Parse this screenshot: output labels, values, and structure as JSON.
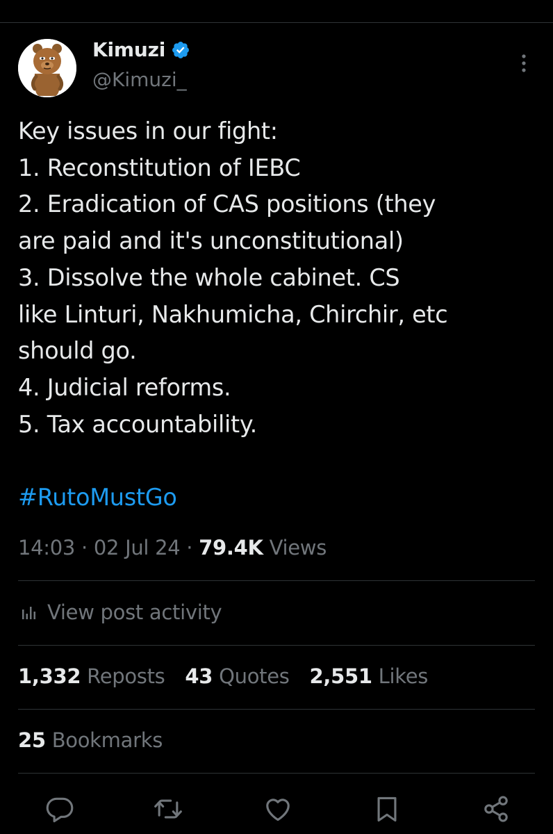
{
  "tweet": {
    "author": {
      "display_name": "Kimuzi",
      "handle": "@Kimuzi_",
      "verified": true,
      "avatar_icon": "cartoon-character-avatar"
    },
    "more_icon": "more-vertical-icon",
    "lines": [
      "Key issues in our fight:",
      "1. Reconstitution of IEBC",
      "2. Eradication of CAS positions (they",
      "are paid and it's unconstitutional)",
      "3. Dissolve the whole cabinet. CS",
      "like Linturi, Nakhumicha, Chirchir, etc",
      "should go.",
      "4. Judicial reforms.",
      "5. Tax accountability."
    ],
    "hashtag": "#RutoMustGo",
    "time": "14:03",
    "date": "02 Jul 24",
    "views_count": "79.4K",
    "views_label": "Views",
    "separator": "·",
    "activity_label": "View post activity",
    "stats": {
      "reposts_count": "1,332",
      "reposts_label": "Reposts",
      "quotes_count": "43",
      "quotes_label": "Quotes",
      "likes_count": "2,551",
      "likes_label": "Likes"
    },
    "bookmarks_count": "25",
    "bookmarks_label": "Bookmarks"
  },
  "actions": [
    "reply-icon",
    "repost-icon",
    "like-icon",
    "bookmark-icon",
    "share-icon"
  ],
  "colors": {
    "background": "#000000",
    "text": "#e7e9ea",
    "secondary": "#71767b",
    "accent": "#1d9bf0",
    "divider": "#2f3336"
  }
}
